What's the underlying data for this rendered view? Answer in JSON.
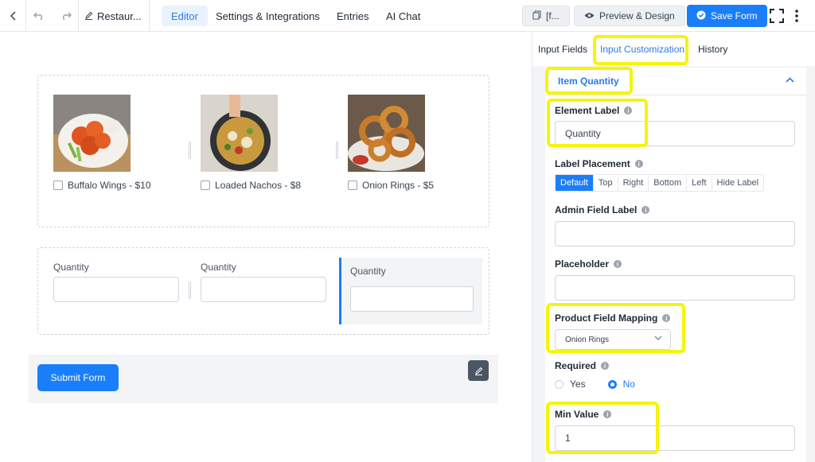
{
  "topbar": {
    "form_title": "Restaur...",
    "nav": [
      "Editor",
      "Settings & Integrations",
      "Entries",
      "AI Chat"
    ],
    "shortcode_label": "[f...",
    "preview_label": "Preview & Design",
    "save_label": "Save Form"
  },
  "canvas": {
    "products": [
      {
        "label": "Buffalo Wings - $10"
      },
      {
        "label": "Loaded Nachos - $8"
      },
      {
        "label": "Onion Rings - $5"
      }
    ],
    "quantity_labels": [
      "Quantity",
      "Quantity",
      "Quantity"
    ],
    "submit_label": "Submit Form"
  },
  "sidebar": {
    "tabs": [
      "Input Fields",
      "Input Customization",
      "History"
    ],
    "panel_title": "Item Quantity",
    "element_label": {
      "label": "Element Label",
      "value": "Quantity"
    },
    "label_placement": {
      "label": "Label Placement",
      "options": [
        "Default",
        "Top",
        "Right",
        "Bottom",
        "Left",
        "Hide Label"
      ],
      "selected": "Default"
    },
    "admin_field_label": {
      "label": "Admin Field Label",
      "value": ""
    },
    "placeholder": {
      "label": "Placeholder",
      "value": ""
    },
    "product_mapping": {
      "label": "Product Field Mapping",
      "value": "Onion Rings"
    },
    "required": {
      "label": "Required",
      "yes": "Yes",
      "no": "No",
      "selected": "No"
    },
    "min_value": {
      "label": "Min Value",
      "value": "1"
    }
  },
  "colors": {
    "accent": "#1a7efb",
    "highlight": "#f5f50a",
    "panel_bg": "#f3f4f6"
  }
}
